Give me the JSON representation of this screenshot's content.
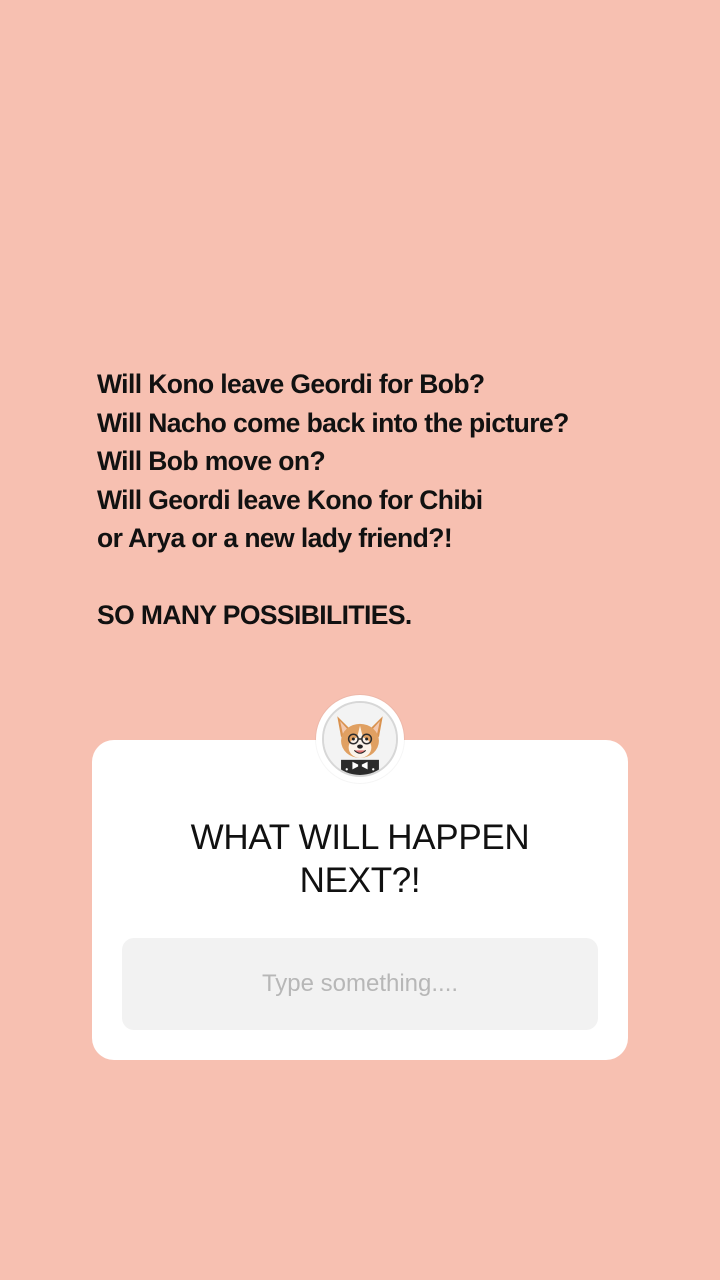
{
  "story": {
    "background_color": "#f7c0b1",
    "caption_lines": [
      "Will Kono leave Geordi for Bob?",
      "Will Nacho come back into the picture?",
      "Will Bob move on?",
      "Will Geordi leave Kono for Chibi",
      "or Arya or a new lady friend?!"
    ],
    "caption_emphasis": "SO MANY POSSIBILITIES."
  },
  "question_sticker": {
    "avatar_icon": "corgi-with-glasses-avatar",
    "title": "WHAT WILL HAPPEN\nNEXT?!",
    "input_value": "",
    "input_placeholder": "Type something...."
  }
}
